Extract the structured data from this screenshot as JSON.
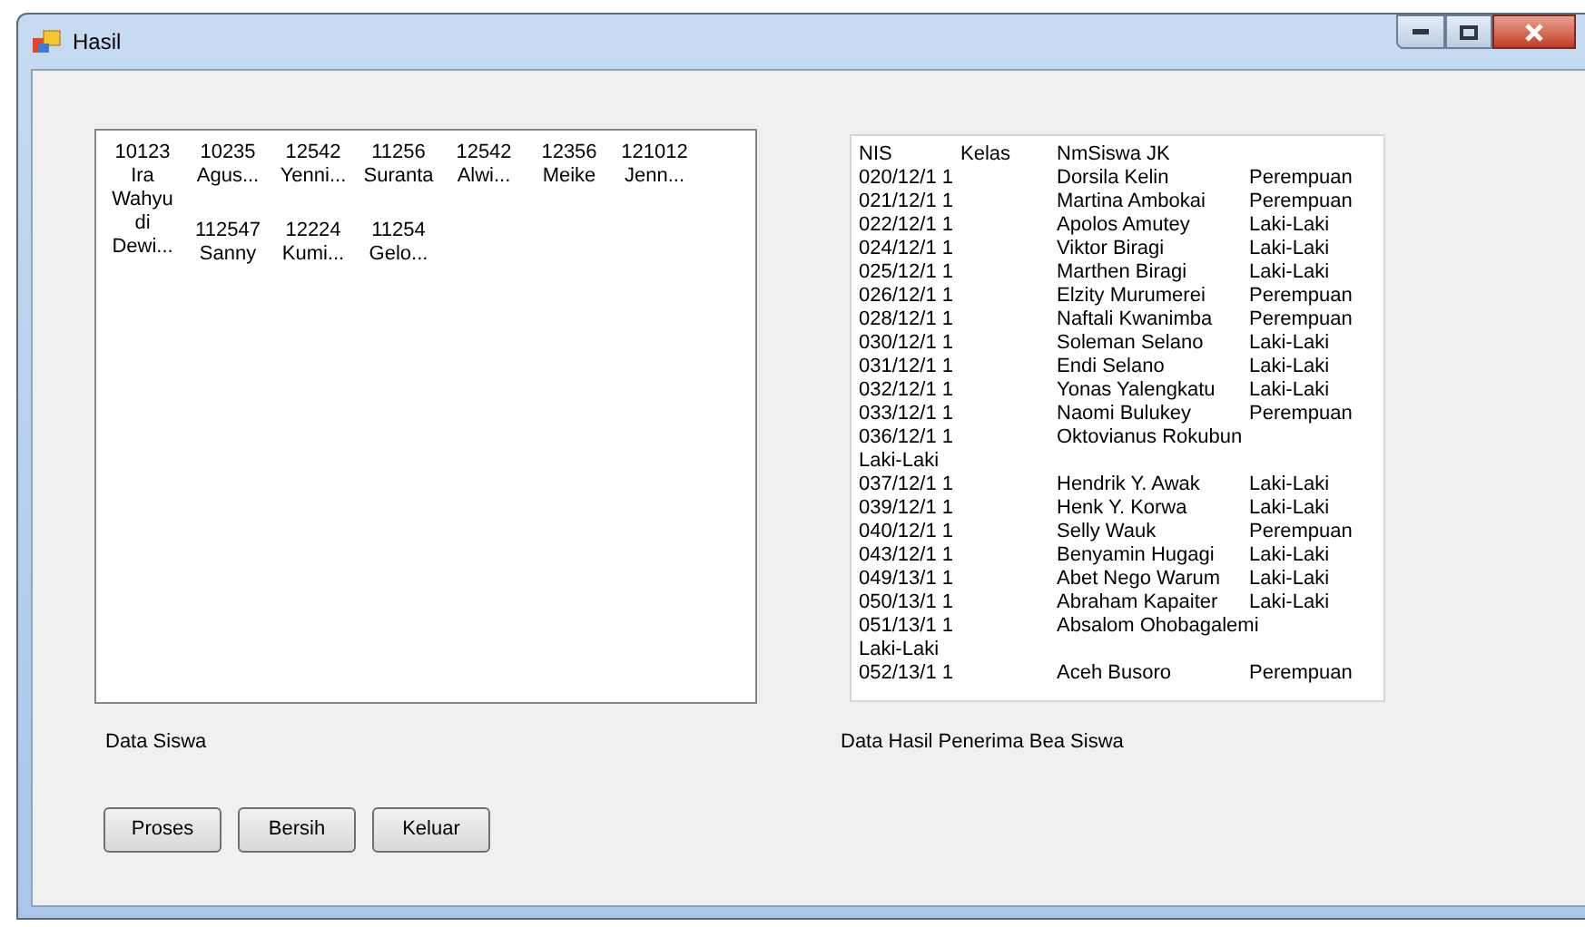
{
  "window": {
    "title": "Hasil"
  },
  "list": {
    "items": [
      {
        "lines": [
          "10123",
          "Ira",
          "Wahyu",
          "di",
          "Dewi..."
        ]
      },
      {
        "lines": [
          "10235",
          "Agus..."
        ]
      },
      {
        "lines": [
          "12542",
          "Yenni..."
        ]
      },
      {
        "lines": [
          "11256",
          "Suranta"
        ]
      },
      {
        "lines": [
          "12542",
          "Alwi..."
        ]
      },
      {
        "lines": [
          "12356",
          "Meike"
        ]
      },
      {
        "lines": [
          "121012",
          "Jenn..."
        ]
      },
      {
        "lines": [
          "112547",
          "Sanny"
        ]
      },
      {
        "lines": [
          "12224",
          "Kumi..."
        ]
      },
      {
        "lines": [
          "11254",
          "Gelo..."
        ]
      }
    ]
  },
  "result": {
    "header": {
      "nis": "NIS",
      "kelas": "Kelas",
      "nama": "NmSiswa JK"
    },
    "rows": [
      {
        "nis": "020/12/1 1",
        "nama": "Dorsila Kelin",
        "jk": "Perempuan"
      },
      {
        "nis": "021/12/1 1",
        "nama": "Martina Ambokai",
        "jk": "Perempuan"
      },
      {
        "nis": "022/12/1 1",
        "nama": "Apolos Amutey",
        "jk": "Laki-Laki"
      },
      {
        "nis": "024/12/1 1",
        "nama": "Viktor Biragi",
        "jk": "Laki-Laki"
      },
      {
        "nis": "025/12/1 1",
        "nama": "Marthen Biragi",
        "jk": "Laki-Laki"
      },
      {
        "nis": "026/12/1 1",
        "nama": "Elzity Murumerei",
        "jk": "Perempuan"
      },
      {
        "nis": "028/12/1 1",
        "nama": "Naftali Kwanimba",
        "jk": "Perempuan"
      },
      {
        "nis": "030/12/1 1",
        "nama": "Soleman Selano",
        "jk": "Laki-Laki"
      },
      {
        "nis": "031/12/1 1",
        "nama": "Endi Selano",
        "jk": "Laki-Laki"
      },
      {
        "nis": "032/12/1 1",
        "nama": "Yonas Yalengkatu",
        "jk": "Laki-Laki"
      },
      {
        "nis": "033/12/1 1",
        "nama": "Naomi Bulukey",
        "jk": "Perempuan"
      },
      {
        "nis": "036/12/1 1",
        "nama": "Oktovianus Rokubun"
      },
      {
        "nis": "Laki-Laki"
      },
      {
        "nis": "037/12/1 1",
        "nama": "Hendrik Y. Awak",
        "jk": "Laki-Laki"
      },
      {
        "nis": "039/12/1 1",
        "nama": "Henk Y. Korwa",
        "jk": "Laki-Laki"
      },
      {
        "nis": "040/12/1 1",
        "nama": "Selly Wauk",
        "jk": "Perempuan"
      },
      {
        "nis": "043/12/1 1",
        "nama": "Benyamin Hugagi",
        "jk": "Laki-Laki"
      },
      {
        "nis": "049/13/1 1",
        "nama": "Abet Nego Warum",
        "jk": "Laki-Laki"
      },
      {
        "nis": "050/13/1 1",
        "nama": "Abraham Kapaiter",
        "jk": "Laki-Laki"
      },
      {
        "nis": "051/13/1 1",
        "nama": "Absalom Ohobagalemi"
      },
      {
        "nis": "Laki-Laki"
      },
      {
        "nis": "052/13/1 1",
        "nama": "Aceh Busoro",
        "jk": "Perempuan"
      }
    ]
  },
  "labels": {
    "left": "Data Siswa",
    "right": "Data Hasil Penerima Bea Siswa"
  },
  "buttons": [
    "Proses",
    "Bersih",
    "Keluar"
  ]
}
